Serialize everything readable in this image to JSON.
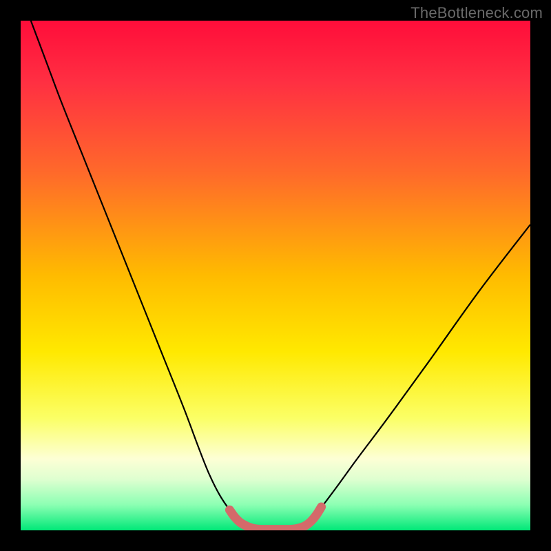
{
  "watermark": "TheBottleneck.com",
  "chart_data": {
    "type": "line",
    "title": "",
    "xlabel": "",
    "ylabel": "",
    "xlim": [
      0,
      100
    ],
    "ylim": [
      0,
      100
    ],
    "gradient_stops": [
      {
        "offset": 0,
        "color": "#ff0d3a"
      },
      {
        "offset": 12,
        "color": "#ff2f42"
      },
      {
        "offset": 30,
        "color": "#ff6a2a"
      },
      {
        "offset": 50,
        "color": "#ffbb00"
      },
      {
        "offset": 65,
        "color": "#ffe900"
      },
      {
        "offset": 78,
        "color": "#fbff66"
      },
      {
        "offset": 86,
        "color": "#fdffd5"
      },
      {
        "offset": 90,
        "color": "#deffd0"
      },
      {
        "offset": 95,
        "color": "#8cffb3"
      },
      {
        "offset": 100,
        "color": "#00e878"
      }
    ],
    "series": [
      {
        "name": "curve",
        "color": "#000000",
        "width": 2.2,
        "x": [
          2,
          5,
          8,
          12,
          16,
          20,
          24,
          28,
          32,
          35,
          37,
          39,
          41,
          42.5,
          44,
          45,
          46,
          54,
          55,
          56,
          57.5,
          59,
          62,
          66,
          72,
          80,
          90,
          100
        ],
        "y": [
          100,
          92,
          84,
          74,
          64,
          54,
          44,
          34,
          24,
          16,
          11,
          7,
          4,
          2.3,
          1.2,
          0.6,
          0.2,
          0.2,
          0.6,
          1.3,
          2.6,
          4.5,
          8.5,
          14,
          22,
          33,
          47,
          60
        ]
      },
      {
        "name": "valley-highlight",
        "color": "#d46a6a",
        "width": 13,
        "linecap": "round",
        "x": [
          41,
          42,
          43,
          44,
          45,
          46,
          47,
          48,
          50,
          52,
          53,
          54,
          55,
          56,
          57,
          58,
          59
        ],
        "y": [
          4.0,
          2.6,
          1.6,
          1.0,
          0.55,
          0.3,
          0.2,
          0.18,
          0.18,
          0.18,
          0.2,
          0.3,
          0.55,
          1.0,
          1.8,
          3.0,
          4.6
        ]
      }
    ]
  }
}
